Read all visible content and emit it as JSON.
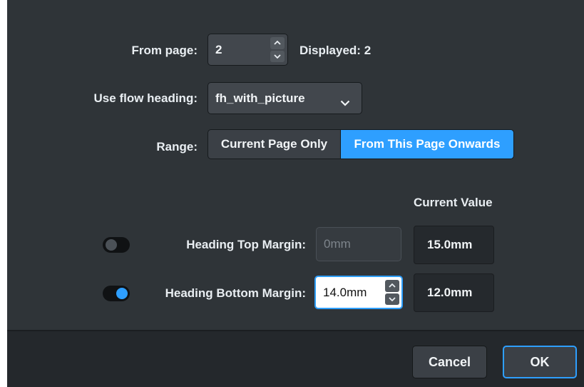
{
  "from_page": {
    "label": "From page:",
    "value": "2",
    "displayed": "Displayed: 2"
  },
  "flow_heading": {
    "label": "Use flow heading:",
    "selected": "fh_with_picture"
  },
  "range": {
    "label": "Range:",
    "options": [
      "Current Page Only",
      "From This Page Onwards"
    ],
    "selected": "From This Page Onwards"
  },
  "current_value_header": "Current Value",
  "heading_top_margin": {
    "label": "Heading Top Margin:",
    "placeholder": "0mm",
    "current_value": "15.0mm",
    "override_enabled": false
  },
  "heading_bottom_margin": {
    "label": "Heading Bottom Margin:",
    "value": "14.0mm",
    "current_value": "12.0mm",
    "override_enabled": true
  },
  "buttons": {
    "cancel": "Cancel",
    "ok": "OK"
  },
  "colors": {
    "accent": "#2e9fff",
    "dialog_bg": "#2f3438",
    "footer_bg": "#24282c"
  },
  "icons": {
    "spinner_up": "chevron-up-icon",
    "spinner_down": "chevron-down-icon",
    "dropdown": "chevron-down-icon"
  }
}
